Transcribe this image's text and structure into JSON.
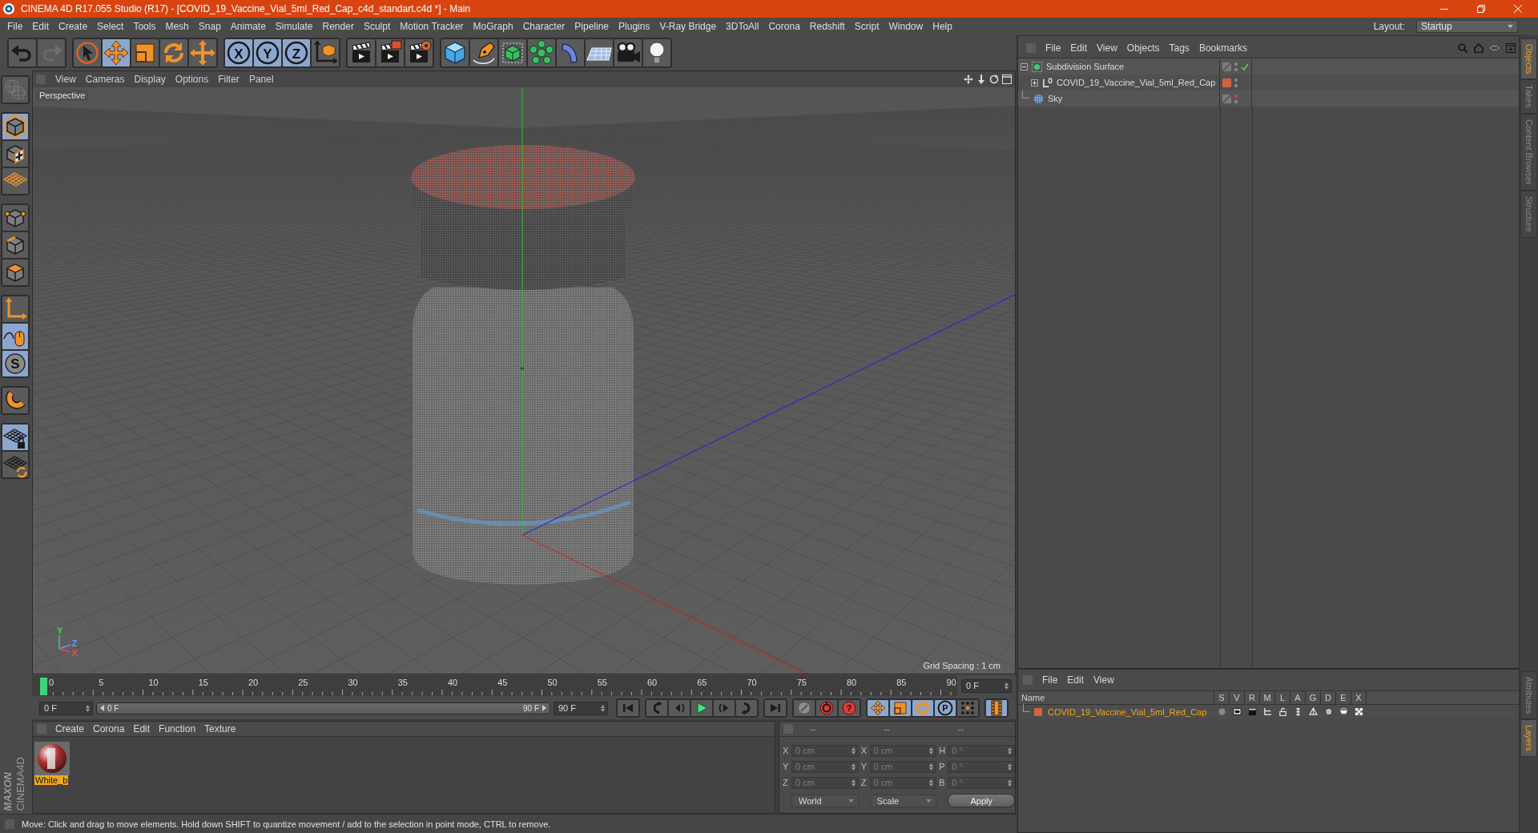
{
  "window": {
    "title": "CINEMA 4D R17.055 Studio (R17) - [COVID_19_Vaccine_Vial_5ml_Red_Cap_c4d_standart.c4d *] - Main"
  },
  "menu_bar": {
    "items": [
      "File",
      "Edit",
      "Create",
      "Select",
      "Tools",
      "Mesh",
      "Snap",
      "Animate",
      "Simulate",
      "Render",
      "Sculpt",
      "Motion Tracker",
      "MoGraph",
      "Character",
      "Pipeline",
      "Plugins",
      "V-Ray Bridge",
      "3DToAll",
      "Corona",
      "Redshift",
      "Script",
      "Window",
      "Help"
    ],
    "layout_label": "Layout:",
    "layout_value": "Startup"
  },
  "toolbar": {
    "groups": [
      {
        "tools": [
          {
            "kind": "undo",
            "active": false,
            "disabled": false
          },
          {
            "kind": "redo",
            "active": false,
            "disabled": true
          }
        ]
      },
      {
        "tools": [
          {
            "kind": "live_select",
            "active": false,
            "disabled": false
          },
          {
            "kind": "move",
            "active": true,
            "disabled": false
          },
          {
            "kind": "scale",
            "active": false,
            "disabled": false
          },
          {
            "kind": "rotate",
            "active": false,
            "disabled": false
          },
          {
            "kind": "last_tool",
            "active": false,
            "disabled": false
          }
        ]
      },
      {
        "tools": [
          {
            "kind": "axis_lock",
            "label": "X",
            "active": true,
            "disabled": false
          },
          {
            "kind": "axis_lock",
            "label": "Y",
            "active": true,
            "disabled": false
          },
          {
            "kind": "axis_lock",
            "label": "Z",
            "active": true,
            "disabled": false
          },
          {
            "kind": "coord_system",
            "active": false,
            "disabled": false
          }
        ]
      },
      {
        "tools": [
          {
            "kind": "render_view",
            "active": false,
            "disabled": false
          },
          {
            "kind": "render_picture",
            "active": false,
            "disabled": false
          },
          {
            "kind": "render_settings",
            "active": false,
            "disabled": false
          }
        ]
      },
      {
        "tools": [
          {
            "kind": "cube",
            "active": false,
            "disabled": false
          },
          {
            "kind": "pen",
            "active": false,
            "disabled": false
          },
          {
            "kind": "subdivision",
            "active": false,
            "disabled": false
          },
          {
            "kind": "cloner",
            "active": false,
            "disabled": false
          },
          {
            "kind": "bend",
            "active": false,
            "disabled": false
          },
          {
            "kind": "floor",
            "active": false,
            "disabled": false
          },
          {
            "kind": "camera",
            "active": false,
            "disabled": false
          },
          {
            "kind": "light",
            "active": false,
            "disabled": false
          }
        ]
      }
    ]
  },
  "left_toolbar": {
    "groups": [
      {
        "tools": [
          {
            "kind": "make_editable",
            "active": false,
            "disabled": true
          }
        ]
      },
      {
        "tools": [
          {
            "kind": "model",
            "active": true,
            "disabled": false
          },
          {
            "kind": "texture",
            "active": false,
            "disabled": false
          },
          {
            "kind": "workplane",
            "active": false,
            "disabled": false
          }
        ]
      },
      {
        "tools": [
          {
            "kind": "points",
            "active": false,
            "disabled": false
          },
          {
            "kind": "edges",
            "active": false,
            "disabled": false
          },
          {
            "kind": "polygons",
            "active": false,
            "disabled": false
          }
        ]
      },
      {
        "tools": [
          {
            "kind": "axis",
            "active": false,
            "disabled": false
          },
          {
            "kind": "tweak",
            "active": true,
            "disabled": false
          },
          {
            "kind": "snap",
            "label": "S",
            "active": true,
            "disabled": false
          }
        ]
      },
      {
        "tools": [
          {
            "kind": "magnet",
            "active": false,
            "disabled": false
          }
        ]
      },
      {
        "tools": [
          {
            "kind": "lock_workplane",
            "active": true,
            "disabled": false
          },
          {
            "kind": "plane_rotate",
            "active": false,
            "disabled": false
          }
        ]
      }
    ]
  },
  "logo": {
    "brand": "MAXON",
    "product": "CINEMA4D"
  },
  "viewport": {
    "menu": [
      "View",
      "Cameras",
      "Display",
      "Options",
      "Filter",
      "Panel"
    ],
    "camera": "Perspective",
    "gizmo": [
      {
        "label": "Y",
        "color": "#3ce03c"
      },
      {
        "label": "Z",
        "color": "#7c8cff"
      },
      {
        "label": "X",
        "color": "#f04848"
      }
    ],
    "grid_spacing": "Grid Spacing : 1 cm"
  },
  "timeline": {
    "labels": [
      "0",
      "5",
      "10",
      "15",
      "20",
      "25",
      "30",
      "35",
      "40",
      "45",
      "50",
      "55",
      "60",
      "65",
      "70",
      "75",
      "80",
      "85",
      "90"
    ],
    "playhead": {
      "level": 0
    },
    "current_frame": "0 F"
  },
  "transport": {
    "start": "0 F",
    "range": {
      "start": "0 F",
      "end": "90 F"
    },
    "end": "90 F",
    "groups": [
      {
        "tools": [
          {
            "kind": "first_frame",
            "active": false,
            "disabled": false
          }
        ]
      },
      {
        "tools": [
          {
            "kind": "prev_key",
            "active": false,
            "disabled": false
          },
          {
            "kind": "prev_frame",
            "active": false,
            "disabled": false
          },
          {
            "kind": "play",
            "active": false,
            "disabled": false
          },
          {
            "kind": "next_frame",
            "active": false,
            "disabled": false
          },
          {
            "kind": "next_key",
            "active": false,
            "disabled": false
          }
        ]
      },
      {
        "tools": [
          {
            "kind": "last_frame",
            "active": false,
            "disabled": false
          }
        ]
      },
      {
        "tools": [
          {
            "kind": "record",
            "active": false,
            "disabled": false
          },
          {
            "kind": "auto_key",
            "active": false,
            "disabled": false
          },
          {
            "kind": "key_selection",
            "label": "?",
            "active": false,
            "disabled": false
          }
        ]
      },
      {
        "tools": [
          {
            "kind": "key_pos",
            "active": true,
            "disabled": false
          },
          {
            "kind": "key_scale",
            "active": true,
            "disabled": false
          },
          {
            "kind": "key_rot",
            "active": true,
            "disabled": false
          },
          {
            "kind": "key_param",
            "label": "P",
            "active": true,
            "disabled": false
          },
          {
            "kind": "key_pla",
            "active": false,
            "disabled": false
          }
        ]
      },
      {
        "tools": [
          {
            "kind": "timeline",
            "active": true,
            "disabled": false
          }
        ]
      }
    ]
  },
  "material_manager": {
    "menu": [
      "Create",
      "Corona",
      "Edit",
      "Function",
      "Texture"
    ],
    "materials": [
      {
        "name": "White_b",
        "selected": true
      }
    ]
  },
  "coordinates": {
    "headers": [
      "--",
      "--",
      "--"
    ],
    "disabled": true,
    "rows": [
      {
        "position_axis": "X",
        "position": "0 cm",
        "size_axis": "X",
        "size": "0 cm",
        "rotation_axis": "H",
        "rotation": "0 °"
      },
      {
        "position_axis": "Y",
        "position": "0 cm",
        "size_axis": "Y",
        "size": "0 cm",
        "rotation_axis": "P",
        "rotation": "0 °"
      },
      {
        "position_axis": "Z",
        "position": "0 cm",
        "size_axis": "Z",
        "size": "0 cm",
        "rotation_axis": "B",
        "rotation": "0 °"
      }
    ],
    "mode": "World",
    "size_mode": "Scale",
    "apply": "Apply"
  },
  "status_bar": {
    "text": "Move: Click and drag to move elements. Hold down SHIFT to quantize movement / add to the selection in point mode, CTRL to remove."
  },
  "object_manager": {
    "menu": [
      "File",
      "Edit",
      "View",
      "Objects",
      "Tags",
      "Bookmarks"
    ],
    "objects": [
      {
        "name": "Subdivision Surface",
        "kind": "subdivision",
        "expanded": true,
        "enabled": true,
        "visibility_dots": [
          {
            "color": "#8c8c8c"
          },
          {
            "color": "#8c8c8c"
          }
        ],
        "children": [
          {
            "name": "COVID_19_Vaccine_Vial_5ml_Red_Cap",
            "kind": "null",
            "expanded": false,
            "color": "#d4613f",
            "visibility_dots": [
              {
                "color": "#8c8c8c"
              },
              {
                "color": "#8c8c8c"
              }
            ]
          }
        ]
      },
      {
        "name": "Sky",
        "kind": "sky",
        "visibility_dots": [
          {
            "color": "#e04545"
          },
          {
            "color": "#8c8c8c"
          }
        ]
      }
    ]
  },
  "layer_manager": {
    "menu": [
      "File",
      "Edit",
      "View"
    ],
    "columns": [
      "Name",
      "S",
      "V",
      "R",
      "M",
      "L",
      "A",
      "G",
      "D",
      "E",
      "X"
    ],
    "layers": [
      {
        "name": "COVID_19_Vaccine_Vial_5ml_Red_Cap",
        "color": "#d4613f",
        "selected": true
      }
    ]
  },
  "side_tabs": {
    "top": [
      {
        "label": "Objects",
        "selected": true
      },
      {
        "label": "Takes",
        "selected": false
      },
      {
        "label": "Content Browser",
        "selected": false
      },
      {
        "label": "Structure",
        "selected": false
      }
    ],
    "bottom": [
      {
        "label": "Attributes",
        "selected": false
      },
      {
        "label": "Layers",
        "selected": true
      }
    ]
  }
}
